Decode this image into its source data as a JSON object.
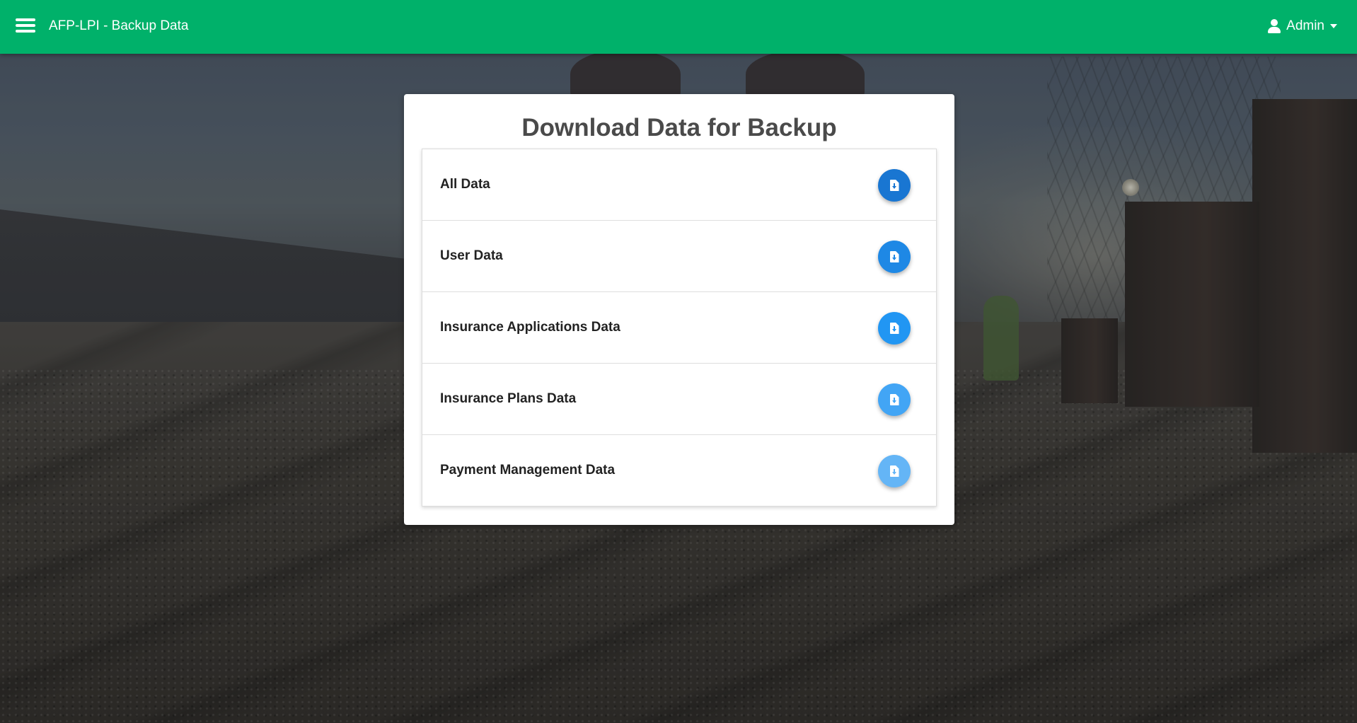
{
  "header": {
    "app_title": "AFP-LPI - Backup Data",
    "user_name": "Admin",
    "accent_color": "#00b16a"
  },
  "main": {
    "title": "Download Data for Backup",
    "items": [
      {
        "label": "All Data",
        "button_color": "#1976d2",
        "icon": "file-download-icon"
      },
      {
        "label": "User Data",
        "button_color": "#1e88e5",
        "icon": "file-download-icon"
      },
      {
        "label": "Insurance Applications Data",
        "button_color": "#2196f3",
        "icon": "file-download-icon"
      },
      {
        "label": "Insurance Plans Data",
        "button_color": "#42a5f5",
        "icon": "file-download-icon"
      },
      {
        "label": "Payment Management Data",
        "button_color": "#64b5f6",
        "icon": "file-download-icon"
      }
    ]
  }
}
